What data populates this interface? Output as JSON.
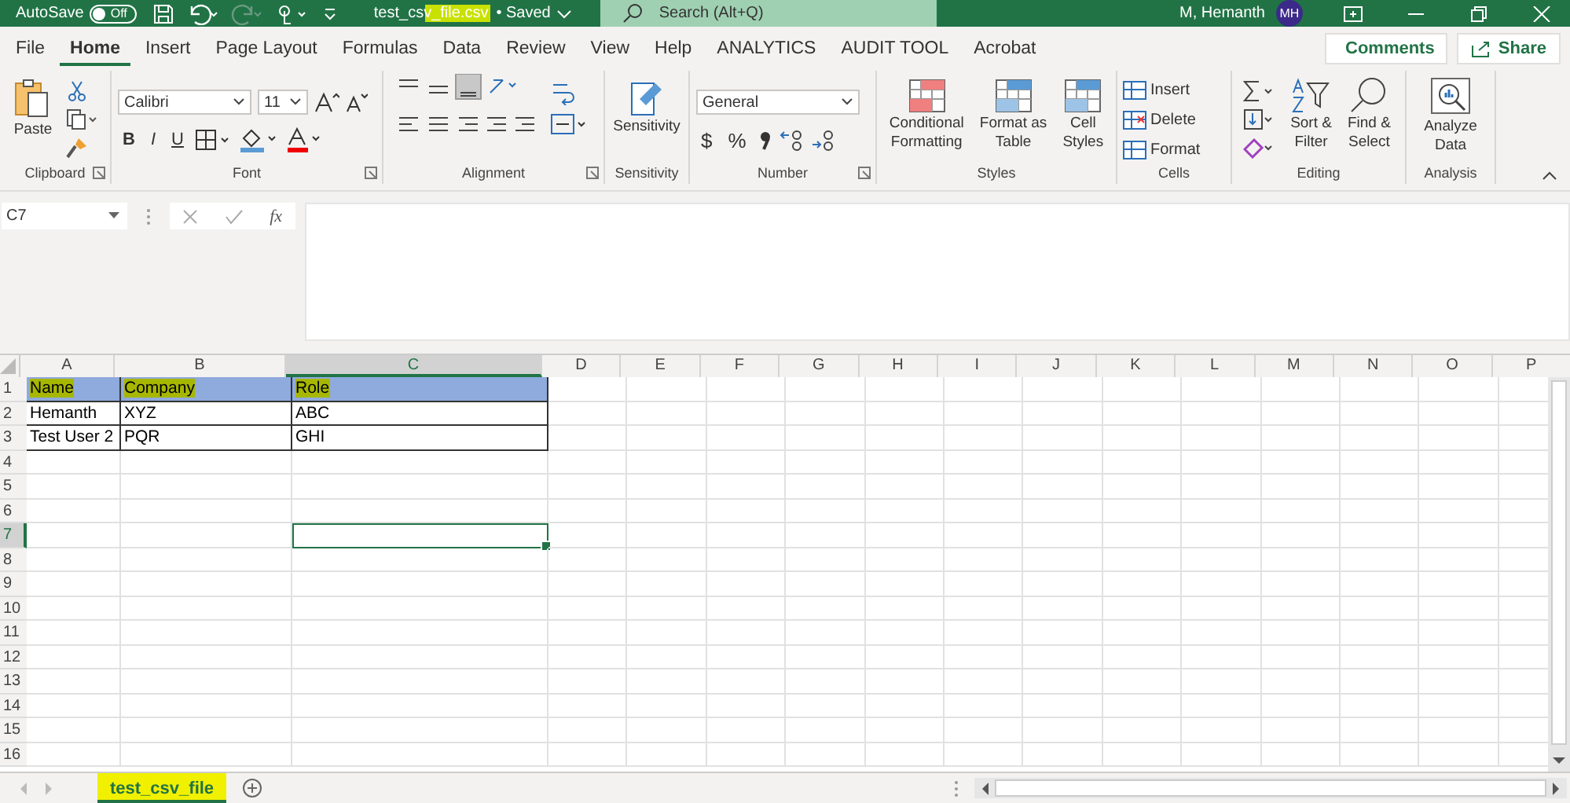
{
  "title_bar": {
    "autosave_label": "AutoSave",
    "autosave": {
      "label": "Off",
      "on": false
    },
    "filename": "test_csv_file.csv",
    "filename_marked": true,
    "status": "• Saved",
    "search_placeholder": "Search (Alt+Q)",
    "user": "M, Hemanth",
    "avatar": "MH"
  },
  "tabs": [
    {
      "label": "File",
      "selected": false
    },
    {
      "label": "Home",
      "selected": true
    },
    {
      "label": "Insert",
      "selected": false
    },
    {
      "label": "Page Layout",
      "selected": false
    },
    {
      "label": "Formulas",
      "selected": false
    },
    {
      "label": "Data",
      "selected": false
    },
    {
      "label": "Review",
      "selected": false
    },
    {
      "label": "View",
      "selected": false
    },
    {
      "label": "Help",
      "selected": false
    },
    {
      "label": "ANALYTICS",
      "selected": false
    },
    {
      "label": "AUDIT TOOL",
      "selected": false
    },
    {
      "label": "Acrobat",
      "selected": false
    }
  ],
  "comments": "Comments",
  "share": "Share",
  "ribbon": {
    "clipboard": {
      "paste": "Paste",
      "label": "Clipboard"
    },
    "font": {
      "name": "Calibri",
      "size": "11",
      "styles": [
        "B",
        "I",
        "U"
      ],
      "label": "Font"
    },
    "alignment": {
      "label": "Alignment"
    },
    "sensitivity": {
      "button": "Sensitivity",
      "label": "Sensitivity"
    },
    "number": {
      "format": "General",
      "symbols": [
        "$",
        "%"
      ],
      "label": "Number"
    },
    "styles": {
      "buttons": [
        {
          "lines": [
            "Conditional",
            "Formatting"
          ]
        },
        {
          "lines": [
            "Format as",
            "Table"
          ]
        },
        {
          "lines": [
            "Cell",
            "Styles"
          ]
        }
      ],
      "label": "Styles"
    },
    "cells": {
      "buttons": [
        "Insert",
        "Delete",
        "Format"
      ],
      "label": "Cells"
    },
    "editing": {
      "buttons": [
        {
          "lines": [
            "Sort &",
            "Filter"
          ]
        },
        {
          "lines": [
            "Find &",
            "Select"
          ]
        }
      ],
      "label": "Editing"
    },
    "analysis": {
      "button": [
        "Analyze",
        "Data"
      ],
      "label": "Analysis"
    }
  },
  "formula_bar": {
    "name_box": "C7",
    "function_label": "fx"
  },
  "columns": [
    {
      "label": "A",
      "selected": false
    },
    {
      "label": "B",
      "selected": false
    },
    {
      "label": "C",
      "selected": true
    },
    {
      "label": "D",
      "selected": false
    },
    {
      "label": "E",
      "selected": false
    },
    {
      "label": "F",
      "selected": false
    },
    {
      "label": "G",
      "selected": false
    },
    {
      "label": "H",
      "selected": false
    },
    {
      "label": "I",
      "selected": false
    },
    {
      "label": "J",
      "selected": false
    },
    {
      "label": "K",
      "selected": false
    },
    {
      "label": "L",
      "selected": false
    },
    {
      "label": "M",
      "selected": false
    },
    {
      "label": "N",
      "selected": false
    },
    {
      "label": "O",
      "selected": false
    },
    {
      "label": "P",
      "selected": false
    }
  ],
  "rows": [
    {
      "number": "1",
      "selected": false,
      "marked": true,
      "cells": [
        "Name",
        "Company",
        "Role"
      ]
    },
    {
      "number": "2",
      "selected": false,
      "marked": false,
      "cells": [
        "Hemanth",
        "XYZ",
        "ABC"
      ]
    },
    {
      "number": "3",
      "selected": false,
      "marked": false,
      "cells": [
        "Test User 2",
        "PQR",
        "GHI"
      ]
    },
    {
      "number": "4",
      "selected": false,
      "marked": false,
      "cells": []
    },
    {
      "number": "5",
      "selected": false,
      "marked": false,
      "cells": []
    },
    {
      "number": "6",
      "selected": false,
      "marked": false,
      "cells": []
    },
    {
      "number": "7",
      "selected": true,
      "marked": false,
      "cells": []
    },
    {
      "number": "8",
      "selected": false,
      "marked": false,
      "cells": []
    },
    {
      "number": "9",
      "selected": false,
      "marked": false,
      "cells": []
    },
    {
      "number": "10",
      "selected": false,
      "marked": false,
      "cells": []
    },
    {
      "number": "11",
      "selected": false,
      "marked": false,
      "cells": []
    },
    {
      "number": "12",
      "selected": false,
      "marked": false,
      "cells": []
    },
    {
      "number": "13",
      "selected": false,
      "marked": false,
      "cells": []
    },
    {
      "number": "14",
      "selected": false,
      "marked": false,
      "cells": []
    },
    {
      "number": "15",
      "selected": false,
      "marked": false,
      "cells": []
    },
    {
      "number": "16",
      "selected": false,
      "marked": false,
      "cells": []
    }
  ],
  "sheet_tabs": [
    {
      "label": "test_csv_file",
      "selected": true,
      "marked": true
    }
  ]
}
